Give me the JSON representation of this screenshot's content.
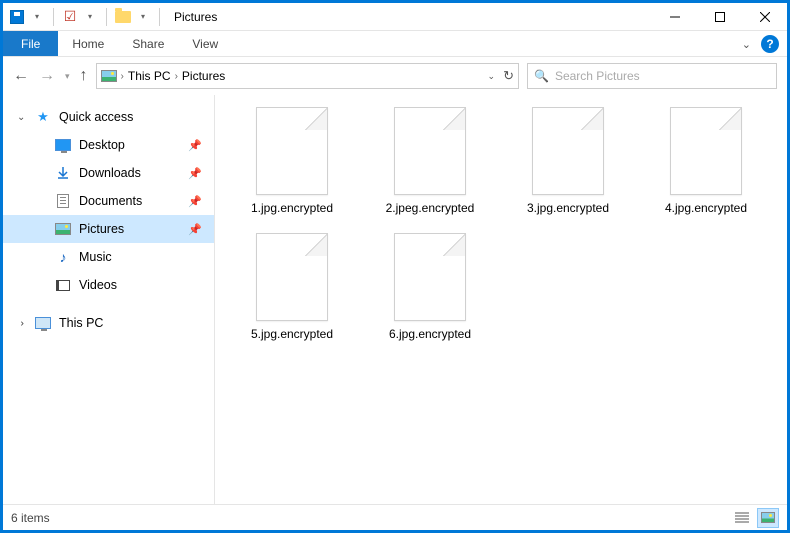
{
  "titlebar": {
    "title": "Pictures"
  },
  "ribbon": {
    "file": "File",
    "tabs": [
      "Home",
      "Share",
      "View"
    ]
  },
  "breadcrumbs": [
    "This PC",
    "Pictures"
  ],
  "search": {
    "placeholder": "Search Pictures"
  },
  "sidebar": {
    "quick_access": "Quick access",
    "items": [
      {
        "label": "Desktop",
        "pinned": true
      },
      {
        "label": "Downloads",
        "pinned": true
      },
      {
        "label": "Documents",
        "pinned": true
      },
      {
        "label": "Pictures",
        "pinned": true,
        "selected": true
      },
      {
        "label": "Music",
        "pinned": false
      },
      {
        "label": "Videos",
        "pinned": false
      }
    ],
    "this_pc": "This PC"
  },
  "files": [
    "1.jpg.encrypted",
    "2.jpeg.encrypted",
    "3.jpg.encrypted",
    "4.jpg.encrypted",
    "5.jpg.encrypted",
    "6.jpg.encrypted"
  ],
  "statusbar": {
    "count": "6 items"
  }
}
